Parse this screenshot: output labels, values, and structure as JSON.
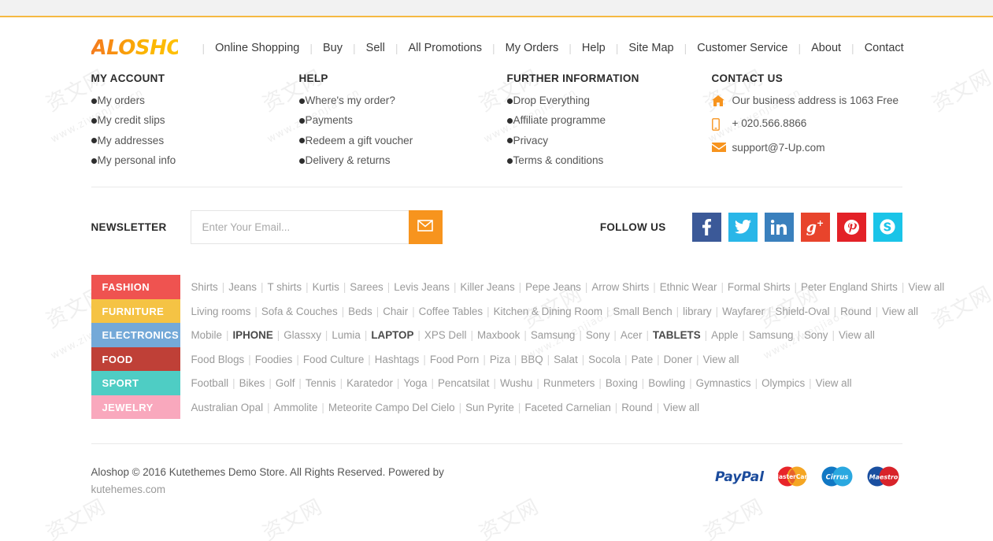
{
  "brand": {
    "logo_text": "ALOSHOP",
    "accent": "#f7941e",
    "top_rule": "#f5b942"
  },
  "topnav": {
    "items": [
      {
        "label": "Online Shopping"
      },
      {
        "label": "Buy"
      },
      {
        "label": "Sell"
      },
      {
        "label": "All Promotions"
      },
      {
        "label": "My Orders"
      },
      {
        "label": "Help"
      },
      {
        "label": "Site Map"
      },
      {
        "label": "Customer Service"
      },
      {
        "label": "About"
      },
      {
        "label": "Contact"
      }
    ]
  },
  "columns": {
    "my_account": {
      "title": "MY ACCOUNT",
      "items": [
        {
          "label": "My orders"
        },
        {
          "label": "My credit slips"
        },
        {
          "label": "My addresses"
        },
        {
          "label": "My personal info"
        }
      ]
    },
    "help": {
      "title": "HELP",
      "items": [
        {
          "label": "Where's my order?"
        },
        {
          "label": "Payments"
        },
        {
          "label": "Redeem a gift voucher"
        },
        {
          "label": "Delivery & returns"
        }
      ]
    },
    "further_information": {
      "title": "FURTHER INFORMATION",
      "items": [
        {
          "label": "Drop Everything"
        },
        {
          "label": "Affiliate programme"
        },
        {
          "label": "Privacy"
        },
        {
          "label": "Terms & conditions"
        }
      ]
    },
    "contact_us": {
      "title": "CONTACT US",
      "items": [
        {
          "icon": "home-icon",
          "label": "Our business address is 1063 Free"
        },
        {
          "icon": "phone-icon",
          "label": "+ 020.566.8866"
        },
        {
          "icon": "envelope-icon",
          "label": "support@7-Up.com"
        }
      ]
    }
  },
  "newsletter": {
    "label": "NEWSLETTER",
    "placeholder": "Enter Your Email...",
    "value": "",
    "submit_icon": "envelope-icon"
  },
  "follow": {
    "label": "FOLLOW US",
    "socials": [
      {
        "name": "facebook",
        "glyph": "f",
        "color": "#3b5998"
      },
      {
        "name": "twitter",
        "glyph": "ᵗ",
        "color": "#29b6e8"
      },
      {
        "name": "linkedin",
        "glyph": "in",
        "color": "#3a80bd"
      },
      {
        "name": "google-plus",
        "glyph": "g+",
        "color": "#e8442c"
      },
      {
        "name": "pinterest",
        "glyph": "p",
        "color": "#e32127"
      },
      {
        "name": "skype",
        "glyph": "s",
        "color": "#1ac4e8"
      }
    ]
  },
  "tag_rows": [
    {
      "category": "FASHION",
      "color": "#ef5350",
      "links": [
        "Shirts",
        "Jeans",
        "T shirts",
        "Kurtis",
        "Sarees",
        "Levis Jeans",
        "Killer Jeans",
        "Pepe Jeans",
        "Arrow Shirts",
        "Ethnic Wear",
        "Formal Shirts",
        "Peter England Shirts",
        "View all"
      ],
      "bold": []
    },
    {
      "category": "FURNITURE",
      "color": "#f5c344",
      "links": [
        "Living rooms",
        "Sofa & Couches",
        "Beds",
        "Chair",
        "Coffee Tables",
        "Kitchen & Dining Room",
        "Small Bench",
        "library",
        "Wayfarer",
        "Shield-Oval",
        "Round",
        "View all"
      ],
      "bold": []
    },
    {
      "category": "ELECTRONICS",
      "color": "#74a9d8",
      "links": [
        "Mobile",
        "IPHONE",
        "Glassxy",
        "Lumia",
        "LAPTOP",
        "XPS Dell",
        "Maxbook",
        "Samsung",
        "Sony",
        "Acer",
        "TABLETS",
        "Apple",
        "Samsung",
        "Sony",
        "View all"
      ],
      "bold": [
        "IPHONE",
        "LAPTOP",
        "TABLETS"
      ]
    },
    {
      "category": "FOOD",
      "color": "#bf4037",
      "links": [
        "Food Blogs",
        "Foodies",
        "Food Culture",
        "Hashtags",
        "Food Porn",
        "Piza",
        "BBQ",
        "Salat",
        "Socola",
        "Pate",
        "Doner",
        "View all"
      ],
      "bold": []
    },
    {
      "category": "SPORT",
      "color": "#4ecdc4",
      "links": [
        "Football",
        "Bikes",
        "Golf",
        "Tennis",
        "Karatedor",
        "Yoga",
        "Pencatsilat",
        "Wushu",
        "Runmeters",
        "Boxing",
        "Bowling",
        "Gymnastics",
        "Olympics",
        "View all"
      ],
      "bold": []
    },
    {
      "category": "JEWELRY",
      "color": "#f9a8bd",
      "links": [
        "Australian Opal",
        "Ammolite",
        "Meteorite Campo Del Cielo",
        "Sun Pyrite",
        "Faceted Carnelian",
        "Round",
        "View all"
      ],
      "bold": []
    }
  ],
  "footer": {
    "copyright": "Aloshop © 2016 Kutethemes Demo Store. All Rights Reserved. Powered by",
    "site": "kutehemes.com",
    "payments": [
      {
        "name": "paypal",
        "label": "PayPal"
      },
      {
        "name": "mastercard",
        "label": "MasterCard"
      },
      {
        "name": "cirrus",
        "label": "Cirrus"
      },
      {
        "name": "maestro",
        "label": "Maestro"
      }
    ]
  },
  "watermarks": [
    "资文网",
    "www.ziwenjiao.cn"
  ]
}
